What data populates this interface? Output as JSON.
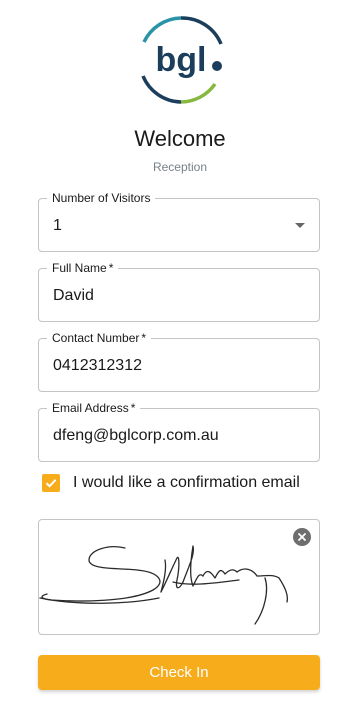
{
  "brand": {
    "logo_text": "bgl",
    "colors": {
      "navy": "#1b3e5c",
      "teal": "#2a93a8",
      "green": "#86b840",
      "accent": "#f7ac1b"
    }
  },
  "header": {
    "title": "Welcome",
    "subtitle": "Reception"
  },
  "form": {
    "visitors": {
      "label": "Number of Visitors",
      "value": "1"
    },
    "full_name": {
      "label": "Full Name",
      "required_mark": "*",
      "value": "David"
    },
    "contact": {
      "label": "Contact Number",
      "required_mark": "*",
      "value": "0412312312"
    },
    "email": {
      "label": "Email Address",
      "required_mark": "*",
      "value": "dfeng@bglcorp.com.au"
    },
    "confirmation": {
      "label": "I would like a confirmation email",
      "checked": true
    },
    "signature": {
      "clear_icon": "close-circle-icon"
    },
    "submit_label": "Check In"
  }
}
